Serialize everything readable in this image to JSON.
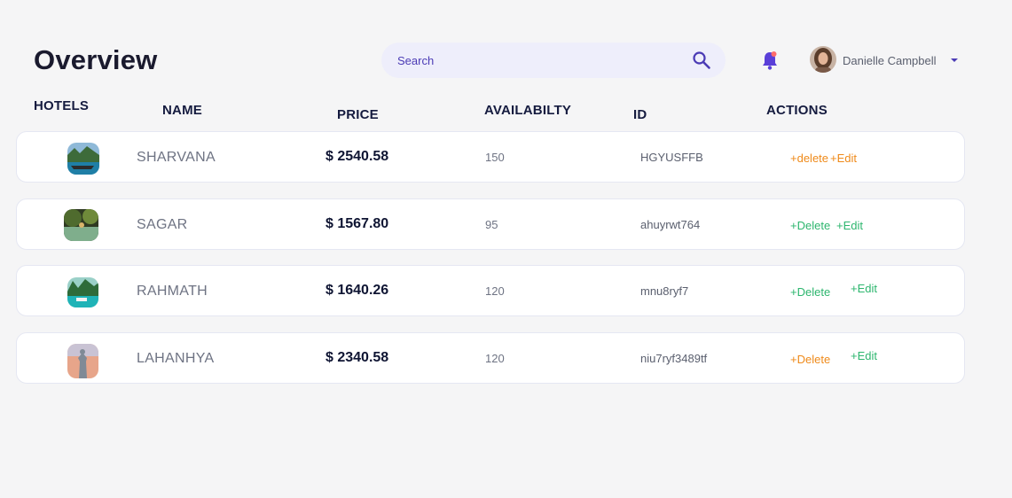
{
  "header": {
    "title": "Overview",
    "search_placeholder": "Search",
    "user_name": "Danielle Campbell"
  },
  "columns": [
    "HOTELS",
    "NAME",
    "PRICE",
    "AVAILABILTY",
    "ID",
    "ACTIONS"
  ],
  "rows": [
    {
      "name": "SHARVANA",
      "price": "$ 2540.58",
      "availability": "150",
      "id": "HGYUSFFB",
      "delete_label": "+delete",
      "edit_label": "+Edit"
    },
    {
      "name": "SAGAR",
      "price": "$ 1567.80",
      "availability": "95",
      "id": "ahuyrwt764",
      "delete_label": "+Delete",
      "edit_label": "+Edit"
    },
    {
      "name": "RAHMATH",
      "price": "$ 1640.26",
      "availability": "120",
      "id": "mnu8ryf7",
      "delete_label": "+Delete",
      "edit_label": "+Edit"
    },
    {
      "name": "LAHANHYA",
      "price": "$ 2340.58",
      "availability": "120",
      "id": "niu7ryf3489tf",
      "delete_label": "+Delete",
      "edit_label": "+Edit"
    }
  ],
  "colors": {
    "accent": "#4b3bb5",
    "delete_orange": "#ef8a1a",
    "edit_green": "#2db66e",
    "bell": "#5a3fd8",
    "bell_dot": "#ff6b6b"
  },
  "icons": [
    "search-icon",
    "bell-icon",
    "caret-down-icon"
  ]
}
